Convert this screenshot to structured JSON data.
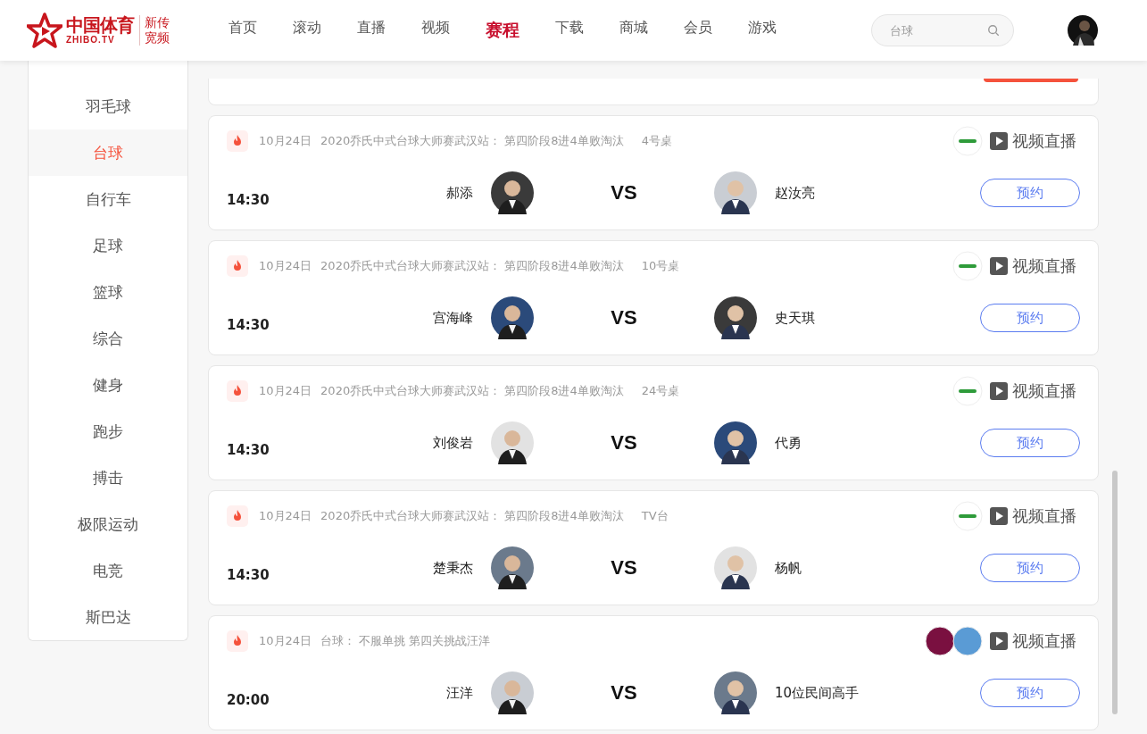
{
  "header": {
    "logo": {
      "name": "中国体育",
      "domain": "ZHIBO.TV",
      "tag_lines": [
        "新传",
        "宽频"
      ]
    },
    "nav": [
      {
        "label": "首页",
        "selected": false
      },
      {
        "label": "滚动",
        "selected": false
      },
      {
        "label": "直播",
        "selected": false
      },
      {
        "label": "视频",
        "selected": false
      },
      {
        "label": "赛程",
        "selected": true
      },
      {
        "label": "下载",
        "selected": false
      },
      {
        "label": "商城",
        "selected": false
      },
      {
        "label": "会员",
        "selected": false
      },
      {
        "label": "游戏",
        "selected": false
      }
    ],
    "search": {
      "placeholder": "台球"
    }
  },
  "sidebar": {
    "items": [
      {
        "label": "羽毛球",
        "selected": false
      },
      {
        "label": "台球",
        "selected": true
      },
      {
        "label": "自行车",
        "selected": false
      },
      {
        "label": "足球",
        "selected": false
      },
      {
        "label": "篮球",
        "selected": false
      },
      {
        "label": "综合",
        "selected": false
      },
      {
        "label": "健身",
        "selected": false
      },
      {
        "label": "跑步",
        "selected": false
      },
      {
        "label": "搏击",
        "selected": false
      },
      {
        "label": "极限运动",
        "selected": false
      },
      {
        "label": "电竞",
        "selected": false
      },
      {
        "label": "斯巴达",
        "selected": false
      }
    ]
  },
  "matches": [
    {
      "date": "10月24日",
      "event": "2020乔氏中式台球大师赛武汉站：",
      "stage": "第四阶段8进4单败淘汰",
      "table": "4号桌",
      "logos": [
        {
          "color": "#2e9b3a"
        }
      ],
      "live": "视频直播",
      "time": "14:30",
      "player_1": "郝添",
      "vs": "VS",
      "player_2": "赵汝亮",
      "button": "预约"
    },
    {
      "date": "10月24日",
      "event": "2020乔氏中式台球大师赛武汉站：",
      "stage": "第四阶段8进4单败淘汰",
      "table": "10号桌",
      "logos": [
        {
          "color": "#2e9b3a"
        }
      ],
      "live": "视频直播",
      "time": "14:30",
      "player_1": "宫海峰",
      "vs": "VS",
      "player_2": "史天琪",
      "button": "预约"
    },
    {
      "date": "10月24日",
      "event": "2020乔氏中式台球大师赛武汉站：",
      "stage": "第四阶段8进4单败淘汰",
      "table": "24号桌",
      "logos": [
        {
          "color": "#2e9b3a"
        }
      ],
      "live": "视频直播",
      "time": "14:30",
      "player_1": "刘俊岩",
      "vs": "VS",
      "player_2": "代勇",
      "button": "预约"
    },
    {
      "date": "10月24日",
      "event": "2020乔氏中式台球大师赛武汉站：",
      "stage": "第四阶段8进4单败淘汰",
      "table": "TV台",
      "logos": [
        {
          "color": "#2e9b3a"
        }
      ],
      "live": "视频直播",
      "time": "14:30",
      "player_1": "楚秉杰",
      "vs": "VS",
      "player_2": "杨帆",
      "button": "预约"
    },
    {
      "date": "10月24日",
      "event": "台球：",
      "stage": "不服单挑 第四关挑战汪洋",
      "logos": [
        {
          "color": "#7a1040"
        },
        {
          "color": "#5a9bd5"
        }
      ],
      "live": "视频直播",
      "time": "20:00",
      "player_1": "汪洋",
      "vs": "VS",
      "player_2": "10位民间高手",
      "button": "预约"
    }
  ]
}
